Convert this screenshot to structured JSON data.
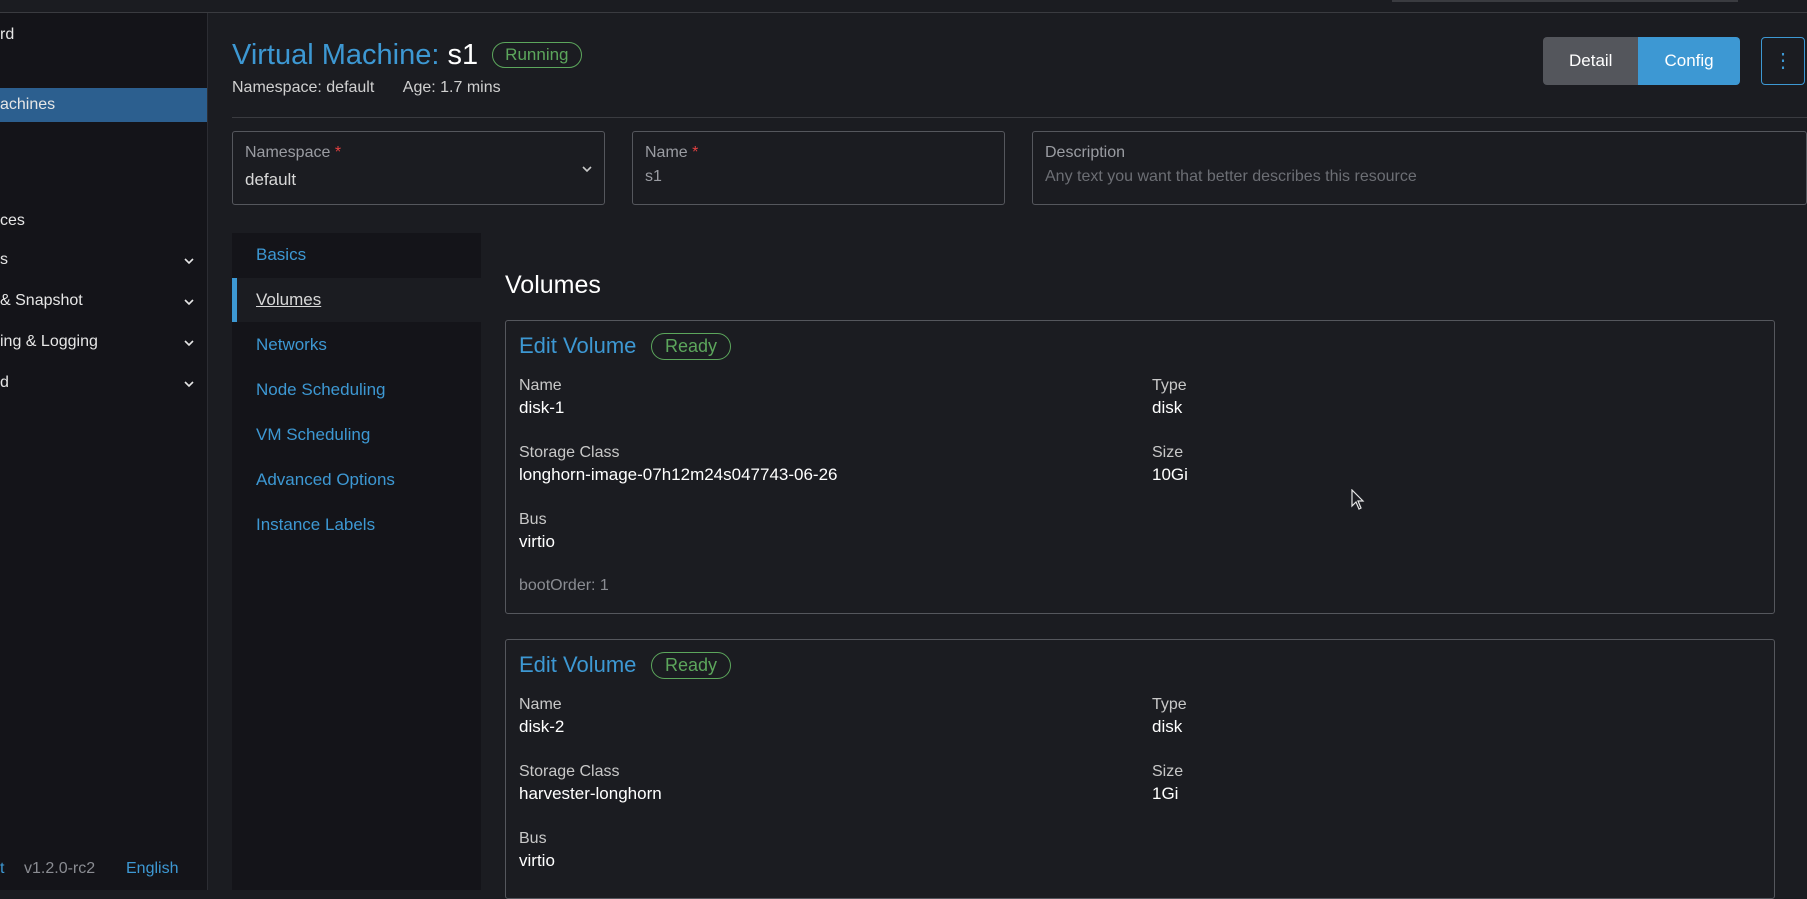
{
  "sidebar": {
    "items": [
      {
        "label": "rd"
      },
      {
        "label": "achines"
      },
      {
        "label": "ces"
      },
      {
        "label": "s"
      },
      {
        "label": "& Snapshot"
      },
      {
        "label": "ing & Logging"
      },
      {
        "label": "d"
      }
    ],
    "footer": {
      "left": "t",
      "version": "v1.2.0-rc2",
      "language": "English"
    }
  },
  "header": {
    "title_prefix": "Virtual Machine:",
    "vm_name": "s1",
    "status": "Running",
    "namespace": "Namespace: default",
    "age": "Age: 1.7 mins",
    "detail_label": "Detail",
    "config_label": "Config",
    "more_label": "⋮"
  },
  "form": {
    "namespace": {
      "label": "Namespace",
      "required": "*",
      "value": "default"
    },
    "name": {
      "label": "Name",
      "required": "*",
      "value": "s1"
    },
    "description": {
      "label": "Description",
      "placeholder": "Any text you want that better describes this resource"
    }
  },
  "tabs": [
    {
      "label": "Basics"
    },
    {
      "label": "Volumes"
    },
    {
      "label": "Networks"
    },
    {
      "label": "Node Scheduling"
    },
    {
      "label": "VM Scheduling"
    },
    {
      "label": "Advanced Options"
    },
    {
      "label": "Instance Labels"
    }
  ],
  "volumes_section": {
    "title": "Volumes",
    "cards": [
      {
        "title": "Edit Volume",
        "status": "Ready",
        "name_label": "Name",
        "name": "disk-1",
        "type_label": "Type",
        "type": "disk",
        "storage_label": "Storage Class",
        "storage": "longhorn-image-07h12m24s047743-06-26",
        "size_label": "Size",
        "size": "10Gi",
        "bus_label": "Bus",
        "bus": "virtio",
        "boot": "bootOrder: 1"
      },
      {
        "title": "Edit Volume",
        "status": "Ready",
        "name_label": "Name",
        "name": "disk-2",
        "type_label": "Type",
        "type": "disk",
        "storage_label": "Storage Class",
        "storage": "harvester-longhorn",
        "size_label": "Size",
        "size": "1Gi",
        "bus_label": "Bus",
        "bus": "virtio"
      }
    ]
  },
  "colors": {
    "accent": "#3d98d3",
    "success": "#5ca65c",
    "required": "#e34141",
    "background": "#1b1c21"
  }
}
